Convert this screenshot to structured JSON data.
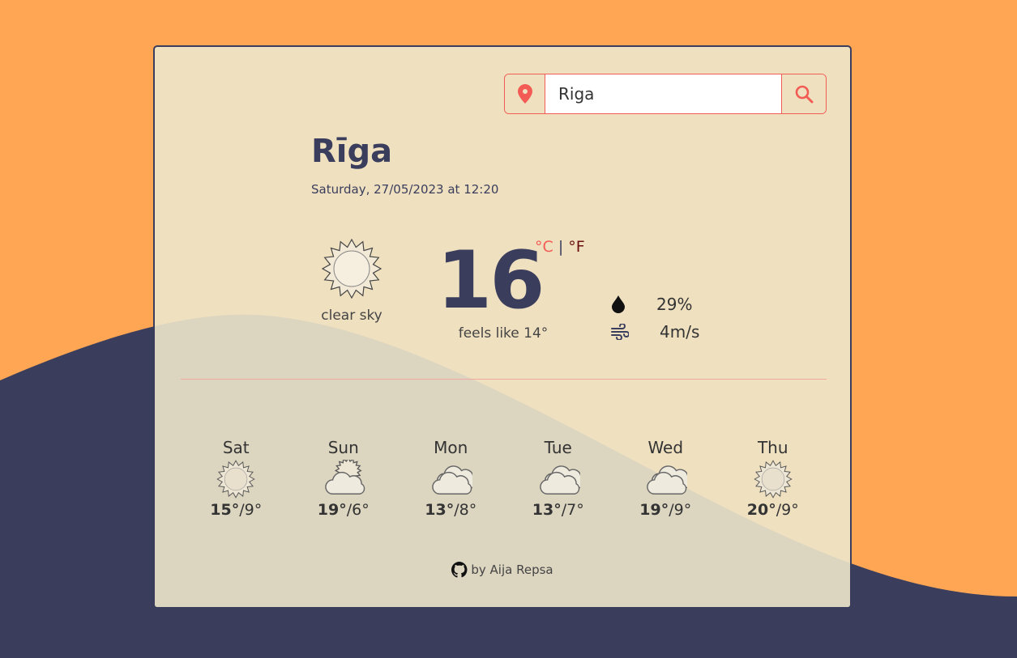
{
  "colors": {
    "background": "#ffa654",
    "wave": "#3a3e5c",
    "card": "#efe0c0",
    "accent": "#f25c54"
  },
  "search": {
    "value": "Riga",
    "location_icon": "map-pin-icon",
    "search_icon": "search-icon"
  },
  "current": {
    "city": "Rīga",
    "date": "Saturday, 27/05/2023 at 12:20",
    "icon": "sun-icon",
    "description": "clear sky",
    "temperature": "16",
    "unit_c": "°C",
    "separator": "|",
    "unit_f": "°F",
    "feels_like": "feels like 14°",
    "humidity": "29%",
    "wind": "4m/s"
  },
  "forecast": [
    {
      "day": "Sat",
      "icon": "sun",
      "high": "15°",
      "low": "9°"
    },
    {
      "day": "Sun",
      "icon": "sun-cloud",
      "high": "19°",
      "low": "6°"
    },
    {
      "day": "Mon",
      "icon": "cloud",
      "high": "13°",
      "low": "8°"
    },
    {
      "day": "Tue",
      "icon": "cloud",
      "high": "13°",
      "low": "7°"
    },
    {
      "day": "Wed",
      "icon": "cloud",
      "high": "19°",
      "low": "9°"
    },
    {
      "day": "Thu",
      "icon": "sun",
      "high": "20°",
      "low": "9°"
    }
  ],
  "footer": {
    "text": "by Aija Repsa",
    "icon": "github-icon"
  }
}
